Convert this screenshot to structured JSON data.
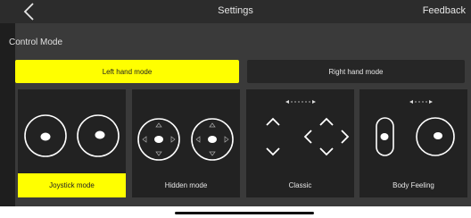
{
  "header": {
    "title": "Settings",
    "feedback_label": "Feedback",
    "back_icon": "chevron-left-icon"
  },
  "control_mode": {
    "title": "Control Mode",
    "hand_modes": [
      {
        "label": "Left hand mode",
        "selected": true
      },
      {
        "label": "Right hand mode",
        "selected": false
      }
    ],
    "modes": [
      {
        "label": "Joystick mode",
        "selected": true,
        "icon": "joystick-mode-icon"
      },
      {
        "label": "Hidden mode",
        "selected": false,
        "icon": "hidden-mode-icon"
      },
      {
        "label": "Classic",
        "selected": false,
        "icon": "classic-mode-icon"
      },
      {
        "label": "Body Feeling",
        "selected": false,
        "icon": "body-feeling-mode-icon"
      }
    ]
  },
  "colors": {
    "accent": "#ffff00",
    "panel": "#3a3a3a",
    "card": "#222222"
  }
}
